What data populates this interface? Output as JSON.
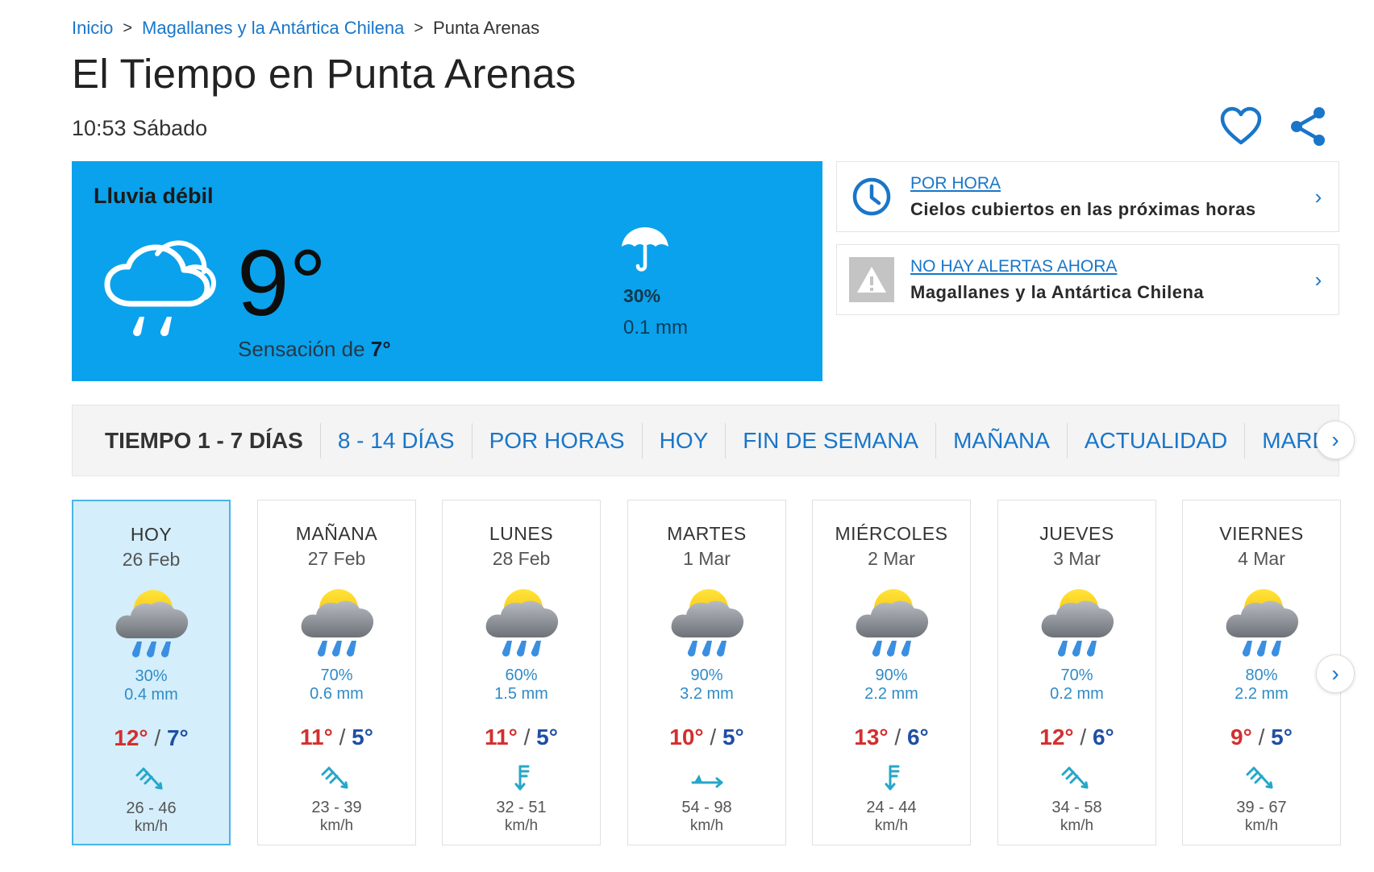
{
  "breadcrumb": {
    "home": "Inicio",
    "region": "Magallanes y la Antártica Chilena",
    "sep": ">",
    "current": "Punta Arenas"
  },
  "title": "El Tiempo en Punta Arenas",
  "time_day": "10:53 Sábado",
  "icons": {
    "favorite": "heart-icon",
    "share": "share-icon"
  },
  "current": {
    "condition": "Lluvia débil",
    "temp": "9°",
    "feels_prefix": "Sensación de ",
    "feels_value": "7°",
    "precip_prob": "30%",
    "precip_mm": "0.1 mm",
    "bg_color": "#0aa2ec"
  },
  "hourly_card": {
    "link": "POR HORA",
    "desc": "Cielos cubiertos en las próximas horas"
  },
  "alert_card": {
    "link": "NO HAY ALERTAS AHORA",
    "desc": "Magallanes y la Antártica Chilena"
  },
  "tabs": [
    "TIEMPO 1 - 7 DÍAS",
    "8 - 14 DÍAS",
    "POR HORAS",
    "HOY",
    "FIN DE SEMANA",
    "MAÑANA",
    "ACTUALIDAD",
    "MAREAS"
  ],
  "arrow": "›",
  "days": [
    {
      "name": "HOY",
      "date": "26 Feb",
      "prob": "30%",
      "mm": "0.4 mm",
      "max": "12°",
      "min": "7°",
      "wind": "26 - 46",
      "unit": "km/h",
      "wind_icon": "wind-nw-icon"
    },
    {
      "name": "MAÑANA",
      "date": "27 Feb",
      "prob": "70%",
      "mm": "0.6 mm",
      "max": "11°",
      "min": "5°",
      "wind": "23 - 39",
      "unit": "km/h",
      "wind_icon": "wind-nw-icon"
    },
    {
      "name": "LUNES",
      "date": "28 Feb",
      "prob": "60%",
      "mm": "1.5 mm",
      "max": "11°",
      "min": "5°",
      "wind": "32 - 51",
      "unit": "km/h",
      "wind_icon": "wind-n-icon"
    },
    {
      "name": "MARTES",
      "date": "1 Mar",
      "prob": "90%",
      "mm": "3.2 mm",
      "max": "10°",
      "min": "5°",
      "wind": "54 - 98",
      "unit": "km/h",
      "wind_icon": "wind-w-icon"
    },
    {
      "name": "MIÉRCOLES",
      "date": "2 Mar",
      "prob": "90%",
      "mm": "2.2 mm",
      "max": "13°",
      "min": "6°",
      "wind": "24 - 44",
      "unit": "km/h",
      "wind_icon": "wind-n-icon"
    },
    {
      "name": "JUEVES",
      "date": "3 Mar",
      "prob": "70%",
      "mm": "0.2 mm",
      "max": "12°",
      "min": "6°",
      "wind": "34 - 58",
      "unit": "km/h",
      "wind_icon": "wind-nw-icon"
    },
    {
      "name": "VIERNES",
      "date": "4 Mar",
      "prob": "80%",
      "mm": "2.2 mm",
      "max": "9°",
      "min": "5°",
      "wind": "39 - 67",
      "unit": "km/h",
      "wind_icon": "wind-nw-icon"
    }
  ],
  "temp_sep": "/",
  "colors": {
    "link": "#1976c9",
    "max_temp": "#d32f2f",
    "min_temp": "#1f4fa3",
    "active_day": "#d4eefb"
  }
}
